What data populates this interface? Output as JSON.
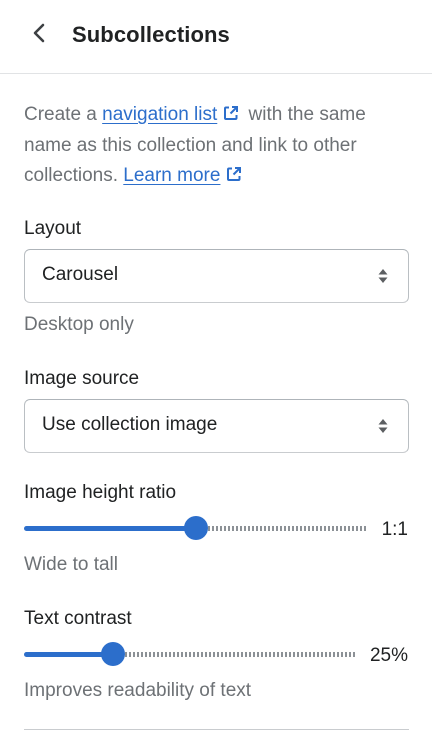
{
  "header": {
    "title": "Subcollections",
    "back_icon": "chevron-left-icon"
  },
  "intro": {
    "text_before": "Create a ",
    "link1": "navigation list",
    "text_middle": " with the same name as this collection and link to other collections. ",
    "link2": "Learn more",
    "external_icon": "external-link-icon"
  },
  "layout": {
    "label": "Layout",
    "value": "Carousel",
    "help": "Desktop only"
  },
  "image_source": {
    "label": "Image source",
    "value": "Use collection image"
  },
  "image_height_ratio": {
    "label": "Image height ratio",
    "value_text": "1:1",
    "fill_fraction": 0.5,
    "help": "Wide to tall"
  },
  "text_contrast": {
    "label": "Text contrast",
    "value_text": "25%",
    "fill_fraction": 0.25,
    "help": "Improves readability of text"
  },
  "colors": {
    "accent": "#2c6ecb",
    "text": "#202223",
    "subdued": "#6d7175",
    "border": "#babfc3"
  }
}
